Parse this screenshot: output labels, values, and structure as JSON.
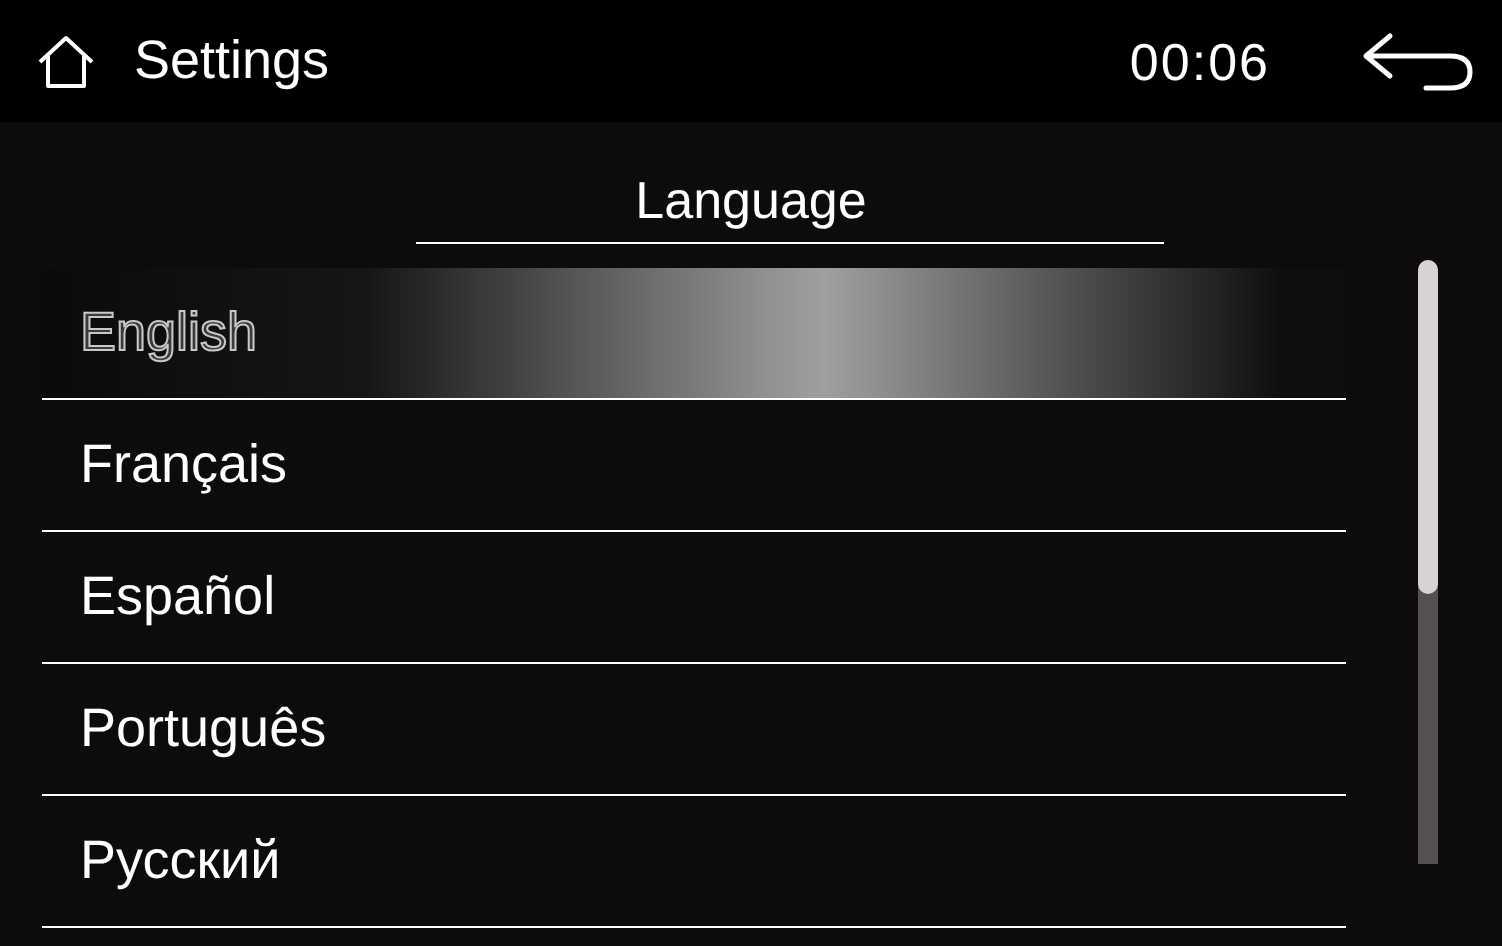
{
  "header": {
    "title": "Settings",
    "time": "00:06"
  },
  "section_title": "Language",
  "languages": [
    {
      "label": "English",
      "selected": true
    },
    {
      "label": "Français",
      "selected": false
    },
    {
      "label": "Español",
      "selected": false
    },
    {
      "label": "Português",
      "selected": false
    },
    {
      "label": "Русский",
      "selected": false
    }
  ]
}
